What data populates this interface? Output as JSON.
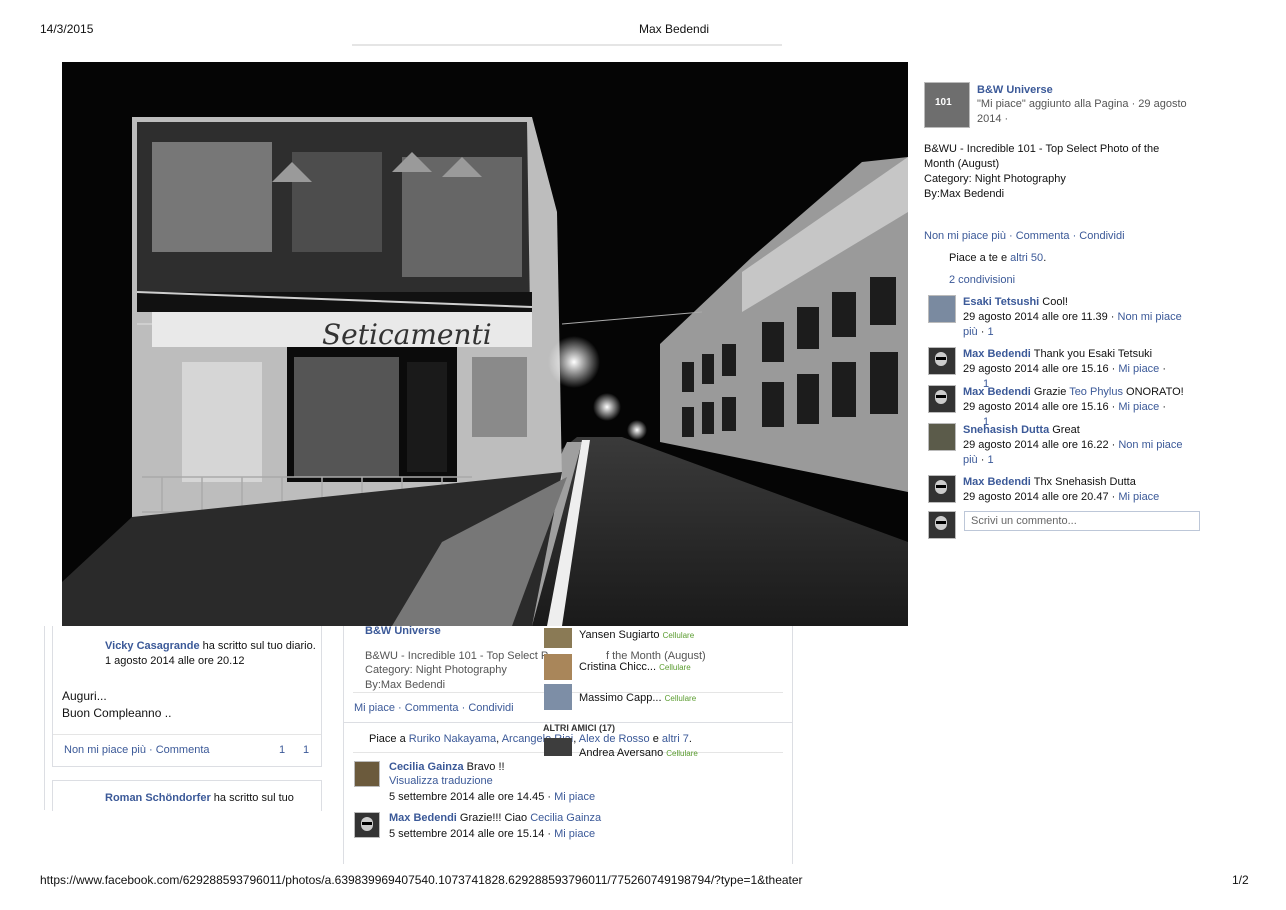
{
  "print": {
    "date": "14/3/2015",
    "title": "Max Bedendi",
    "url": "https://www.facebook.com/629288593796011/photos/a.639839969407540.1073741828.629288593796011/775260749198794/?type=1&theater",
    "page": "1/2"
  },
  "page_name": "B&W Universe",
  "post": {
    "meta": "\"Mi piace\" aggiunto alla Pagina · 29 agosto 2014 ·",
    "caption_lines": [
      "B&WU - Incredible 101 - Top Select Photo of the Month (August)",
      "Category: Night Photography",
      "By:Max Bedendi"
    ],
    "actions": [
      "Non mi piace più",
      "Commenta",
      "Condividi"
    ],
    "likes_prefix": "Piace a te e ",
    "likes_link": "altri 50",
    "likes_suffix": ".",
    "shares": "2 condivisioni"
  },
  "comments": [
    {
      "author": "Esaki Tetsushi",
      "text": "Cool!",
      "meta": "29 agosto 2014 alle ore 11.39 ·",
      "link": "Non mi piace più",
      "count": "1"
    },
    {
      "author": "Max Bedendi",
      "text": "Thank you Esaki Tetsuki",
      "meta": "29 agosto 2014 alle ore 15.16 ·",
      "link": "Mi piace",
      "count": "1"
    },
    {
      "author": "Max Bedendi",
      "text_before": "Grazie ",
      "mention": "Teo Phylus",
      "text_after": " ONORATO!",
      "meta": "29 agosto 2014 alle ore 15.16 ·",
      "link": "Mi piace",
      "count": "1"
    },
    {
      "author": "Snehasish Dutta",
      "text": "Great",
      "meta": "29 agosto 2014 alle ore 16.22 ·",
      "link": "Non mi piace più",
      "count": "1"
    },
    {
      "author": "Max Bedendi",
      "text": "Thx Snehasish Dutta",
      "meta": "29 agosto 2014 alle ore 20.47 ·",
      "link": "Mi piace",
      "count": ""
    }
  ],
  "comment_placeholder": "Scrivi un commento...",
  "bg": {
    "left_post": {
      "author": "Vicky Casagrande",
      "action": " ha scritto sul tuo diario.",
      "date": "1 agosto 2014 alle ore 20.12",
      "text1": "Auguri...",
      "text2": "Buon Compleanno ..",
      "actions": "Non mi piace più · Commenta",
      "count1": "1",
      "count2": "1"
    },
    "left_post2": {
      "author": "Roman Schöndorfer",
      "action": " ha scritto sul tuo"
    },
    "mid_post": {
      "page": "B&W Universe",
      "line1": "B&WU - Incredible 101 - Top Select P",
      "line1b": "f the Month (August)",
      "line2": "Category: Night Photography",
      "line3": "By:Max Bedendi",
      "actions": [
        "Mi piace",
        "Commenta",
        "Condividi"
      ],
      "likes_prefix": "Piace a ",
      "likes_names": [
        "Ruriko Nakayama",
        "Arcangelo Riai",
        "Alex de Rosso"
      ],
      "likes_and": " e ",
      "likes_more": "altri 7",
      "c1_author": "Cecilia Gainza",
      "c1_text": " Bravo !!",
      "c1_translate": "Visualizza traduzione",
      "c1_meta": "5 settembre 2014 alle ore 14.45 ·",
      "c1_like": "Mi piace",
      "c2_author": "Max Bedendi",
      "c2_text": " Grazie!!! Ciao ",
      "c2_mention": "Cecilia Gainza",
      "c2_meta": "5 settembre 2014 alle ore 15.14 ·",
      "c2_like": "Mi piace"
    },
    "chat": {
      "friends": [
        {
          "name": "Yansen Sugiarto",
          "status": "Cellulare"
        },
        {
          "name": "Cristina Chicc...",
          "status": "Cellulare"
        },
        {
          "name": "Massimo Capp...",
          "status": "Cellulare"
        }
      ],
      "other_header": "ALTRI AMICI (17)",
      "other": {
        "name": "Andrea Aversano",
        "status": "Cellulare"
      }
    }
  },
  "photo_sign": "Seticamenti",
  "colors": {
    "link": "#3b5998",
    "mobile": "#5a9c2f"
  }
}
